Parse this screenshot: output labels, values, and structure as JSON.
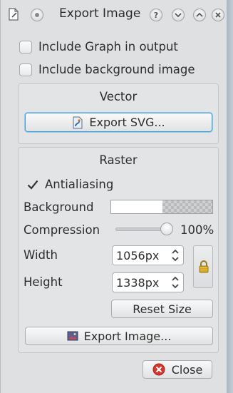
{
  "window": {
    "title": "Export Image",
    "buttons": {
      "help": "?",
      "shade": "⌄",
      "maximize": "⌃",
      "close": "✕"
    }
  },
  "options": {
    "include_graph": {
      "label": "Include Graph in output",
      "checked": false
    },
    "include_background": {
      "label": "Include background image",
      "checked": false
    }
  },
  "vector": {
    "title": "Vector",
    "export_svg_label": "Export SVG..."
  },
  "raster": {
    "title": "Raster",
    "antialiasing": {
      "label": "Antialiasing",
      "checked": true
    },
    "background_label": "Background",
    "compression_label": "Compression",
    "compression_value": "100%",
    "compression_fraction": 1.0,
    "width_label": "Width",
    "width_value": "1056px",
    "height_label": "Height",
    "height_value": "1338px",
    "reset_size_label": "Reset Size",
    "export_image_label": "Export Image..."
  },
  "footer": {
    "close_label": "Close"
  },
  "icons": {
    "window_menu": "document-pencil-icon",
    "sticky": "pin-circle-icon",
    "svg": "svg-file-icon",
    "image": "image-file-icon",
    "lock": "padlock-icon",
    "close": "red-x-circle-icon"
  },
  "colors": {
    "focus": "#4a9fd8",
    "close_icon": "#d6372d",
    "lock": "#d4a51f"
  }
}
